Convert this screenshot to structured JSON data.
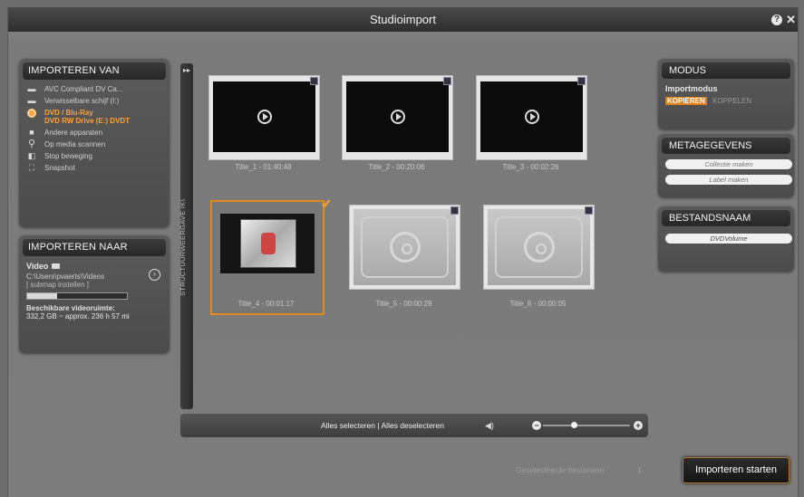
{
  "window": {
    "title": "Studioimport"
  },
  "import_from": {
    "heading": "IMPORTEREN VAN",
    "items": [
      {
        "label": "AVC Compliant DV Ca...",
        "icon": "camera-icon"
      },
      {
        "label": "Verwisselbare schijf (I:)",
        "icon": "drive-icon"
      },
      {
        "label": "DVD / Blu-Ray",
        "sub": "DVD RW Drive (E:) DVDT",
        "icon": "disc-icon",
        "active": true
      },
      {
        "label": "Andere apparaten",
        "icon": "folder-icon"
      },
      {
        "label": "Op media scannen",
        "icon": "search-icon"
      },
      {
        "label": "Stop beweging",
        "icon": "stop-motion-icon"
      },
      {
        "label": "Snapshot",
        "icon": "snapshot-icon"
      }
    ]
  },
  "import_to": {
    "heading": "IMPORTEREN NAAR",
    "video_label": "Video",
    "path": "C:\\Users\\pvaerts\\Videos",
    "subfolder": "[ submap instellen ]",
    "space_label": "Beschikbare videoruimte:",
    "space_value": "332,2 GB ~ approx. 236 h 57 mi",
    "space_fill_fraction": 0.3
  },
  "structure_bar": {
    "label": "STRUCTUURWEERGAVE IK\\"
  },
  "titles": [
    {
      "label": "Title_1 - 01:40:48",
      "kind": "play"
    },
    {
      "label": "Title_2 - 00:20:06",
      "kind": "play"
    },
    {
      "label": "Title_3 - 00:02:26",
      "kind": "play"
    },
    {
      "label": "Title_4 - 00:01:17",
      "kind": "image",
      "selected": true
    },
    {
      "label": "Title_5 - 00:00:29",
      "kind": "disc"
    },
    {
      "label": "Title_6 - 00:00:05",
      "kind": "disc"
    }
  ],
  "bottom_bar": {
    "select_all": "Alles selecteren",
    "separator": "|",
    "deselect_all": "Alles deselecteren",
    "zoom_level": 0.35
  },
  "mode": {
    "heading": "MODUS",
    "label": "Importmodus",
    "copy": "KOPIËREN",
    "link": "KOPPELEN"
  },
  "metadata": {
    "heading": "METAGEGEVENS",
    "collection_placeholder": "Collectie maken",
    "label_placeholder": "Label maken"
  },
  "filename": {
    "heading": "BESTANDSNAAM",
    "value": "DVDVolume"
  },
  "status": {
    "selected_files_label": "Geselecteerde bestanden",
    "selected_count": "1"
  },
  "import_button": "Importeren starten",
  "colors": {
    "accent": "#e08a20",
    "active_text": "#ffa23a"
  }
}
